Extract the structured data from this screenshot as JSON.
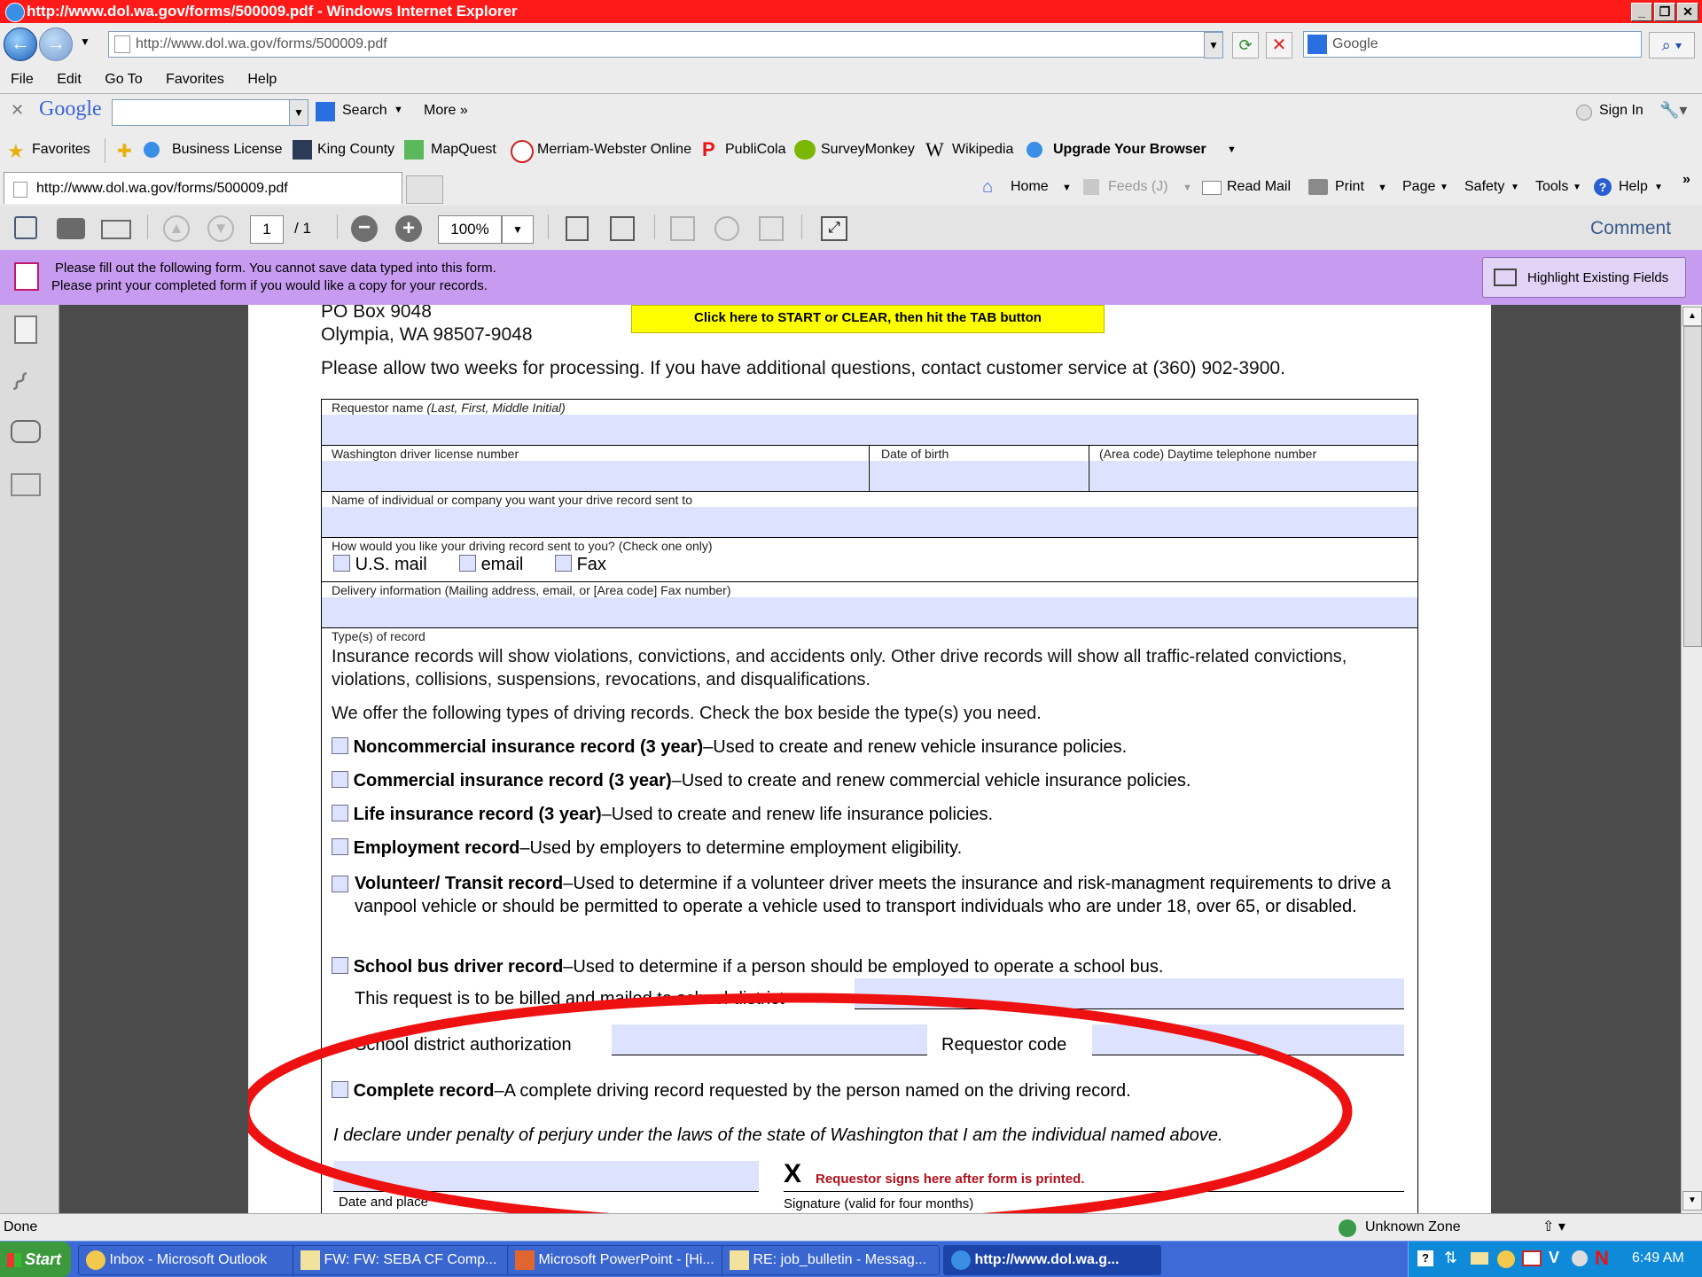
{
  "window": {
    "title": "http://www.dol.wa.gov/forms/500009.pdf - Windows Internet Explorer"
  },
  "address": {
    "url": "http://www.dol.wa.gov/forms/500009.pdf",
    "search_placeholder": "Google"
  },
  "menu": [
    "File",
    "Edit",
    "Go To",
    "Favorites",
    "Help"
  ],
  "google_toolbar": {
    "logo": "Google",
    "search": "Search",
    "more": "More »",
    "sign_in": "Sign In"
  },
  "favorites": {
    "label": "Favorites",
    "items": [
      "Business License",
      "King County",
      "MapQuest",
      "Merriam-Webster Online",
      "PubliCola",
      "SurveyMonkey",
      "Wikipedia",
      "Upgrade Your Browser"
    ]
  },
  "tab": {
    "label": "http://www.dol.wa.gov/forms/500009.pdf"
  },
  "commandbar": {
    "home": "Home",
    "feeds": "Feeds (J)",
    "read_mail": "Read Mail",
    "print": "Print",
    "page": "Page",
    "safety": "Safety",
    "tools": "Tools",
    "help": "Help"
  },
  "pdf_toolbar": {
    "page_current": "1",
    "page_total": "/ 1",
    "zoom": "100%",
    "comment": "Comment"
  },
  "notice": {
    "line1": "Please fill out the following form. You cannot save data typed into this form.",
    "line2": "Please print your completed form if you would like a copy for your records.",
    "highlight": "Highlight Existing Fields"
  },
  "form": {
    "address1": "PO Box 9048",
    "address2": "Olympia, WA 98507-9048",
    "start_button": "Click here to START or CLEAR, then hit the TAB button",
    "allow": "Please allow two weeks for processing. If you have additional questions, contact customer service at (360) 902-3900.",
    "requestor_name": "Requestor name",
    "requestor_name_hint": "(Last, First, Middle Initial)",
    "license": "Washington driver license number",
    "dob": "Date of birth",
    "phone": "(Area code) Daytime telephone number",
    "sendto": "Name of individual or company you want your drive record sent to",
    "how": "How would you like your driving record sent to you? (Check one only)",
    "opt_mail": "U.S. mail",
    "opt_email": "email",
    "opt_fax": "Fax",
    "delivery": "Delivery information (Mailing address, email, or [Area code] Fax number)",
    "types": "Type(s) of record",
    "insurance_note": "Insurance records will show violations, convictions, and accidents only. Other drive records will show all traffic-related convictions, violations, collisions, suspensions, revocations, and disqualifications.",
    "offer": "We offer the following types of driving records. Check the box beside the type(s) you need.",
    "records": [
      {
        "name": "Noncommercial insurance record (3 year)",
        "desc": "–Used to create and renew vehicle insurance policies."
      },
      {
        "name": "Commercial insurance record (3 year)",
        "desc": "–Used to create and renew commercial vehicle insurance policies."
      },
      {
        "name": "Life insurance record (3 year)",
        "desc": "–Used to create and renew life insurance policies."
      },
      {
        "name": "Employment record",
        "desc": "–Used by employers to determine employment eligibility."
      },
      {
        "name": "Volunteer/ Transit record",
        "desc": "–Used to determine if a volunteer driver meets the insurance and risk-managment requirements to drive a vanpool vehicle or should be permitted to operate a vehicle used to transport individuals who are under 18, over 65, or disabled."
      },
      {
        "name": "School bus driver record",
        "desc": "–Used to determine if a person should be employed to operate a school bus."
      }
    ],
    "billed": "This request is to be billed and mailed to school district",
    "school_auth": "School district authorization",
    "req_code": "Requestor code",
    "complete_name": "Complete record",
    "complete_desc": "–A complete driving record requested by the person named on the driving record.",
    "declare": "I declare under penalty of perjury under the laws of the state of Washington that I am the individual named above.",
    "sign_x": "X",
    "sign_note": "Requestor signs here after form is printed.",
    "date_place": "Date and place",
    "signature": "Signature (valid for four months)"
  },
  "status": {
    "left": "Done",
    "zone": "Unknown Zone"
  },
  "taskbar": {
    "start": "Start",
    "tasks": [
      "Inbox - Microsoft Outlook",
      "FW: FW: SEBA CF Comp...",
      "Microsoft PowerPoint - [Hi...",
      "RE: job_bulletin - Messag...",
      "http://www.dol.wa.g..."
    ],
    "clock": "6:49 AM"
  },
  "colors": {
    "title_bar": "#ff1a1a",
    "notice_bg": "#c79cf0",
    "field_fill": "#dde3ff",
    "annotation": "#ee1111"
  }
}
